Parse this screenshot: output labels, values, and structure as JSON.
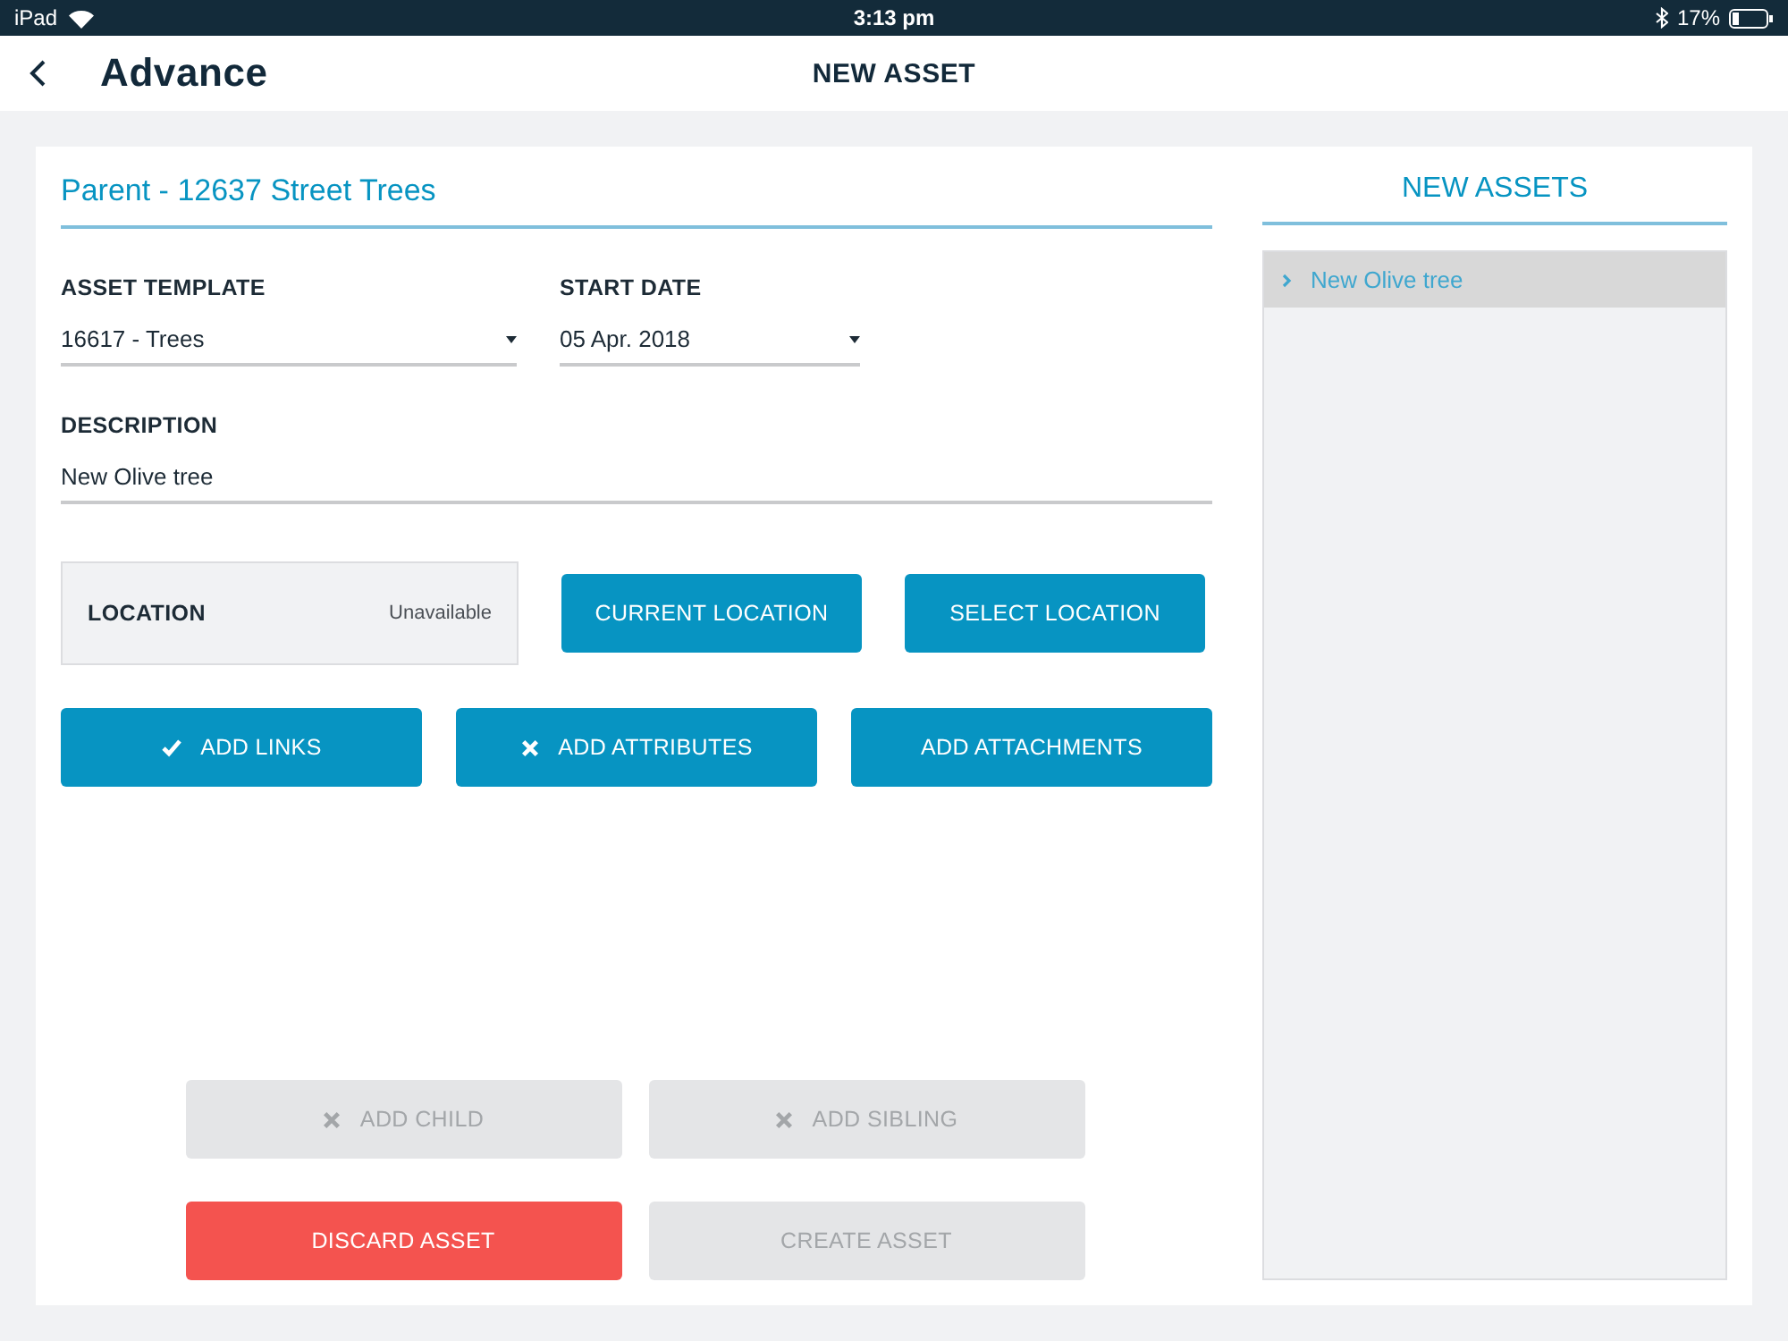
{
  "status_bar": {
    "device": "iPad",
    "time": "3:13 pm",
    "battery": "17%"
  },
  "header": {
    "logo": "Advance",
    "title": "NEW ASSET"
  },
  "form": {
    "parent": "Parent - 12637 Street Trees",
    "fields": [
      {
        "label": "ASSET TEMPLATE",
        "value": "16617 - Trees",
        "kind": "dropdown"
      },
      {
        "label": "START DATE",
        "value": "05 Apr. 2018",
        "kind": "dropdown"
      }
    ],
    "description": {
      "label": "DESCRIPTION",
      "value": "New Olive tree"
    },
    "location": {
      "label": "LOCATION",
      "status": "Unavailable"
    },
    "location_buttons": [
      "CURRENT LOCATION",
      "SELECT LOCATION"
    ],
    "action_buttons": [
      {
        "label": "ADD LINKS",
        "kind": "check"
      },
      {
        "label": "ADD ATTRIBUTES",
        "kind": "cross"
      },
      {
        "label": "ADD ATTACHMENTS",
        "kind": "plain"
      }
    ],
    "bottom_buttons": [
      {
        "label": "ADD CHILD",
        "kind": "cross",
        "disabled": true
      },
      {
        "label": "ADD SIBLING",
        "kind": "cross",
        "disabled": true
      },
      {
        "label": "DISCARD ASSET",
        "kind": "danger",
        "disabled": false
      },
      {
        "label": "CREATE ASSET",
        "kind": "plain",
        "disabled": true
      }
    ]
  },
  "new_assets": {
    "title": "NEW ASSETS",
    "items": [
      {
        "label": "New Olive tree",
        "selected": true,
        "expanded": false
      }
    ]
  }
}
